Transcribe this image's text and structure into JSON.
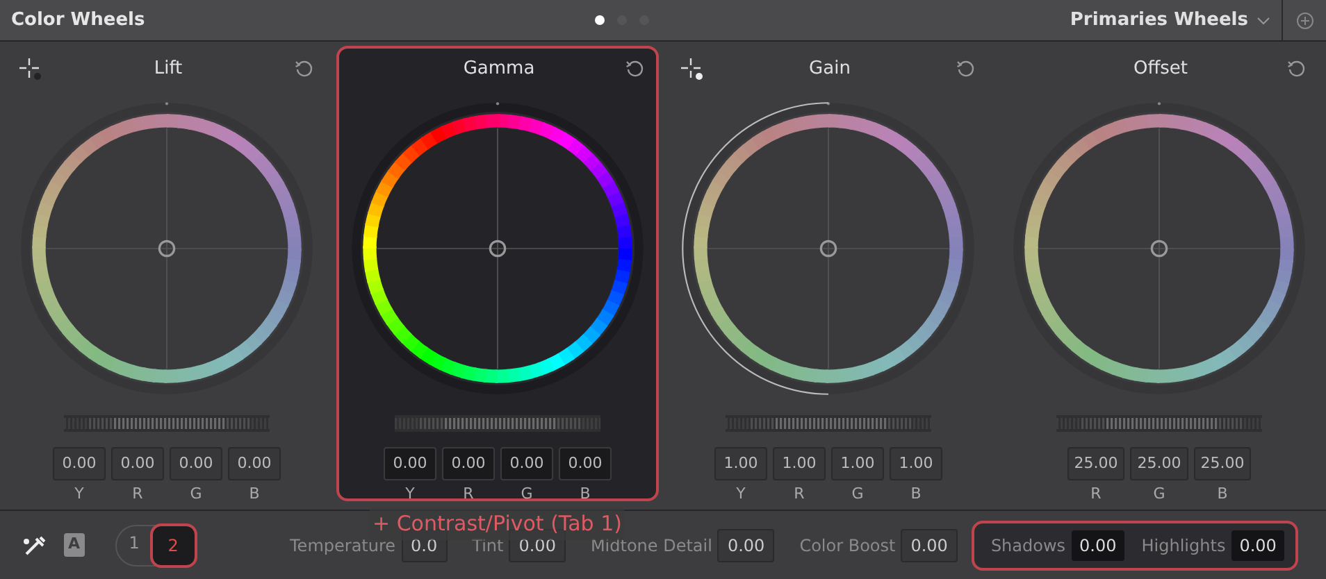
{
  "header": {
    "title": "Color Wheels",
    "pages": [
      {
        "selected": true
      },
      {
        "selected": false
      },
      {
        "selected": false
      }
    ],
    "mode": "Primaries Wheels"
  },
  "wheels": [
    {
      "label": "Lift",
      "selected": false,
      "picker": true,
      "picker_dot_light": false,
      "arc": false,
      "values": [
        {
          "value": "0.00",
          "label": "Y"
        },
        {
          "value": "0.00",
          "label": "R"
        },
        {
          "value": "0.00",
          "label": "G"
        },
        {
          "value": "0.00",
          "label": "B"
        }
      ]
    },
    {
      "label": "Gamma",
      "selected": true,
      "picker": false,
      "arc": false,
      "values": [
        {
          "value": "0.00",
          "label": "Y"
        },
        {
          "value": "0.00",
          "label": "R"
        },
        {
          "value": "0.00",
          "label": "G"
        },
        {
          "value": "0.00",
          "label": "B"
        }
      ]
    },
    {
      "label": "Gain",
      "selected": false,
      "picker": true,
      "picker_dot_light": true,
      "arc": true,
      "values": [
        {
          "value": "1.00",
          "label": "Y"
        },
        {
          "value": "1.00",
          "label": "R"
        },
        {
          "value": "1.00",
          "label": "G"
        },
        {
          "value": "1.00",
          "label": "B"
        }
      ]
    },
    {
      "label": "Offset",
      "selected": false,
      "picker": false,
      "arc": false,
      "values": [
        {
          "value": "25.00",
          "label": "R"
        },
        {
          "value": "25.00",
          "label": "G"
        },
        {
          "value": "25.00",
          "label": "B"
        }
      ]
    }
  ],
  "bottom_bar": {
    "auto_badge": "A",
    "tabs": [
      {
        "label": "1",
        "selected": false
      },
      {
        "label": "2",
        "selected": true
      }
    ],
    "tooltip": "+ Contrast/Pivot (Tab 1)",
    "fields": [
      {
        "label": "Temperature",
        "value": "0.0",
        "highlighted": false
      },
      {
        "label": "Tint",
        "value": "0.00",
        "highlighted": false
      },
      {
        "label": "Midtone Detail",
        "value": "0.00",
        "highlighted": false
      },
      {
        "label": "Color Boost",
        "value": "0.00",
        "highlighted": false
      }
    ],
    "highlight_group": [
      {
        "label": "Shadows",
        "value": "0.00"
      },
      {
        "label": "Highlights",
        "value": "0.00"
      }
    ]
  }
}
